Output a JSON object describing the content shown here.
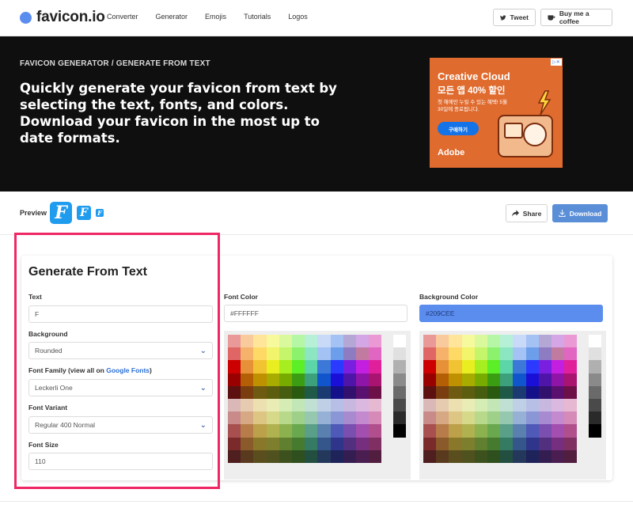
{
  "nav": {
    "brand": "favicon.io",
    "links": [
      "Converter",
      "Generator",
      "Emojis",
      "Tutorials",
      "Logos"
    ],
    "tweet": "Tweet",
    "coffee": "Buy me a coffee"
  },
  "hero": {
    "eyebrow": "FAVICON GENERATOR / GENERATE FROM TEXT",
    "title": "Quickly generate your favicon from text by selecting the text, fonts, and colors. Download your favicon in the most up to date formats."
  },
  "ad": {
    "title": "Creative Cloud",
    "subtitle": "모든 앱 40% 할인",
    "desc": "첫 해에만 누릴 수 있는 혜택! 5월 30일에 종료됩니다.",
    "button": "구매하기",
    "logo": "Adobe"
  },
  "toolbar": {
    "preview_label": "Preview",
    "favicon_letter": "F",
    "share": "Share",
    "download": "Download"
  },
  "form": {
    "title": "Generate From Text",
    "text_label": "Text",
    "text_value": "F",
    "background_label": "Background",
    "background_value": "Rounded",
    "font_family_label": "Font Family (view all on ",
    "font_family_link": "Google Fonts",
    "font_family_close": ")",
    "font_family_value": "Leckerli One",
    "font_variant_label": "Font Variant",
    "font_variant_value": "Regular 400 Normal",
    "font_size_label": "Font Size",
    "font_size_value": "110",
    "font_color_label": "Font Color",
    "font_color_value": "#FFFFFF",
    "bg_color_label": "Background Color",
    "bg_color_value": "#209CEE"
  },
  "colors": {
    "favicon_bg": "#209CEE",
    "accent": "#5A8FD8",
    "highlight": "#EF2764"
  },
  "palette_colors": [
    [
      "#ea9999",
      "#f9cb9c",
      "#ffe599",
      "#f6f99c",
      "#d9f99c",
      "#b6f7a6",
      "#b6f0d7",
      "#c9daf8",
      "#a4c2f4",
      "#b4a7d6",
      "#d5a6e6",
      "#ea99d5"
    ],
    [
      "#e06666",
      "#f6b26b",
      "#ffd966",
      "#f2f56b",
      "#c4f56b",
      "#8cf26d",
      "#8de6c2",
      "#a4c2f4",
      "#6d9eeb",
      "#8e7cc3",
      "#c27ba0",
      "#e066c2"
    ],
    [
      "#cc0000",
      "#e69138",
      "#f1c232",
      "#e8ee1f",
      "#a6ee1f",
      "#5cee26",
      "#5cd6a8",
      "#3c78d8",
      "#2a3bff",
      "#7a1fe0",
      "#c21fe0",
      "#e01f9a"
    ],
    [
      "#990000",
      "#b45f06",
      "#bf9000",
      "#a8ab00",
      "#78ab00",
      "#3b9e12",
      "#3ca07c",
      "#1155cc",
      "#1a0fd6",
      "#4f14a8",
      "#8f14a8",
      "#a81470"
    ],
    [
      "#5c1010",
      "#7a3d10",
      "#6e5a10",
      "#5d5d10",
      "#465d10",
      "#2a5a10",
      "#1f5a48",
      "#1c3a72",
      "#14108a",
      "#32106e",
      "#5a106e",
      "#6e1048"
    ],
    [
      "#dbb8b8",
      "#e6cbb0",
      "#ede0b0",
      "#eaecb5",
      "#d6ecb5",
      "#c2e6b5",
      "#bfe0d2",
      "#bfd0e6",
      "#b8bfe6",
      "#c8b8e0",
      "#dab8e0",
      "#e6b8d2"
    ],
    [
      "#c98a8a",
      "#d6a883",
      "#ddc583",
      "#d6d88a",
      "#b8d88a",
      "#9fd08a",
      "#96c8b0",
      "#96b0d6",
      "#8a96d6",
      "#a88ad0",
      "#c48ad0",
      "#d68ab8"
    ],
    [
      "#a85050",
      "#b87c4a",
      "#bca04a",
      "#b0b24f",
      "#8cb24f",
      "#6aa84f",
      "#5aa088",
      "#5a80b0",
      "#4f5ab8",
      "#7a4fb0",
      "#a24fb0",
      "#b04f8c"
    ],
    [
      "#7a2a2a",
      "#8a5a2a",
      "#8a782a",
      "#7d7f2f",
      "#607f2f",
      "#467a2f",
      "#357a62",
      "#35568a",
      "#2f358a",
      "#522f7f",
      "#762f7f",
      "#7f2f62"
    ],
    [
      "#4f1e1e",
      "#5a3a1e",
      "#5a4e1e",
      "#4f511e",
      "#3d511e",
      "#2e4f1e",
      "#234f40",
      "#23385a",
      "#1e235a",
      "#341e51",
      "#4b1e51",
      "#511e40"
    ]
  ],
  "gray_colors": [
    "#ffffff",
    "#e0e0e0",
    "#b0b0b0",
    "#8a8a8a",
    "#6a6a6a",
    "#4a4a4a",
    "#2a2a2a",
    "#000000"
  ]
}
